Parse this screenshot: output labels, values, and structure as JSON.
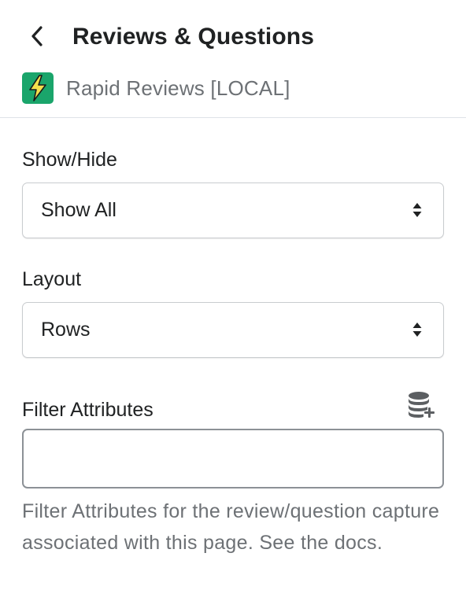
{
  "header": {
    "title": "Reviews & Questions",
    "back_icon": "chevron-left-icon",
    "app": {
      "name": "Rapid Reviews [LOCAL]",
      "logo_icon": "lightning-bolt-icon",
      "logo_color": "#1aa56b",
      "bolt_color": "#f4e04d"
    }
  },
  "fields": {
    "show_hide": {
      "label": "Show/Hide",
      "selected": "Show All",
      "icon": "select-arrows-icon"
    },
    "layout": {
      "label": "Layout",
      "selected": "Rows",
      "icon": "select-arrows-icon"
    },
    "filter_attributes": {
      "label": "Filter Attributes",
      "value": "",
      "placeholder": "",
      "action_icon": "database-add-icon",
      "help_text": "Filter Attributes for the review/question capture associated with this page. See the docs."
    }
  },
  "colors": {
    "text_primary": "#202223",
    "text_subdued": "#6d7175",
    "border": "#c9cccf",
    "divider": "#dfe3e8"
  }
}
